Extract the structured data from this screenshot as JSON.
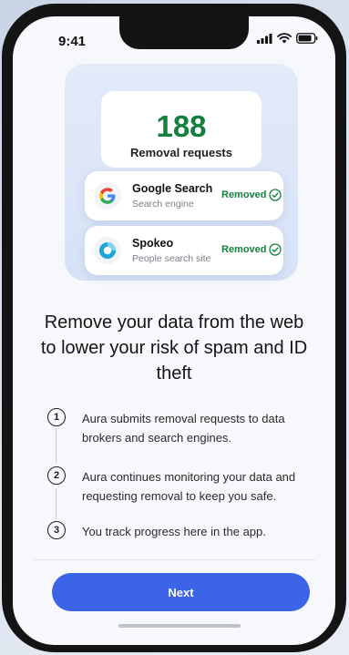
{
  "status_bar": {
    "time": "9:41"
  },
  "hero": {
    "count": "188",
    "count_label": "Removal requests",
    "brokers": [
      {
        "name": "Google Search",
        "type": "Search engine",
        "status": "Removed",
        "icon": "google-logo-icon"
      },
      {
        "name": "Spokeo",
        "type": "People search site",
        "status": "Removed",
        "icon": "spokeo-logo-icon"
      }
    ]
  },
  "headline": "Remove your data from the web to lower your risk of spam and ID theft",
  "steps": [
    {
      "number": "1",
      "text": "Aura submits removal requests to data brokers and search engines."
    },
    {
      "number": "2",
      "text": "Aura continues monitoring your data and requesting removal to keep you safe."
    },
    {
      "number": "3",
      "text": "You track progress here in the app."
    }
  ],
  "next_button": {
    "label": "Next"
  },
  "colors": {
    "accent": "#3b64e7",
    "success": "#15803d"
  }
}
